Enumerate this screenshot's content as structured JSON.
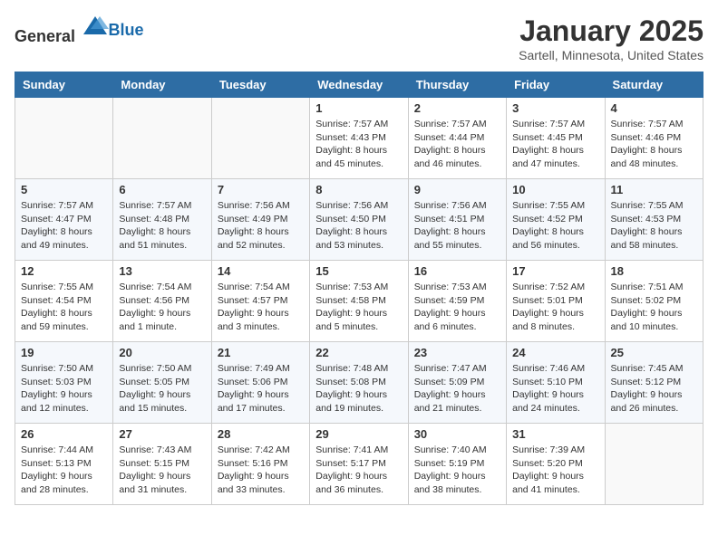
{
  "header": {
    "logo_general": "General",
    "logo_blue": "Blue",
    "month_title": "January 2025",
    "location": "Sartell, Minnesota, United States"
  },
  "weekdays": [
    "Sunday",
    "Monday",
    "Tuesday",
    "Wednesday",
    "Thursday",
    "Friday",
    "Saturday"
  ],
  "weeks": [
    [
      {
        "day": "",
        "info": ""
      },
      {
        "day": "",
        "info": ""
      },
      {
        "day": "",
        "info": ""
      },
      {
        "day": "1",
        "info": "Sunrise: 7:57 AM\nSunset: 4:43 PM\nDaylight: 8 hours\nand 45 minutes."
      },
      {
        "day": "2",
        "info": "Sunrise: 7:57 AM\nSunset: 4:44 PM\nDaylight: 8 hours\nand 46 minutes."
      },
      {
        "day": "3",
        "info": "Sunrise: 7:57 AM\nSunset: 4:45 PM\nDaylight: 8 hours\nand 47 minutes."
      },
      {
        "day": "4",
        "info": "Sunrise: 7:57 AM\nSunset: 4:46 PM\nDaylight: 8 hours\nand 48 minutes."
      }
    ],
    [
      {
        "day": "5",
        "info": "Sunrise: 7:57 AM\nSunset: 4:47 PM\nDaylight: 8 hours\nand 49 minutes."
      },
      {
        "day": "6",
        "info": "Sunrise: 7:57 AM\nSunset: 4:48 PM\nDaylight: 8 hours\nand 51 minutes."
      },
      {
        "day": "7",
        "info": "Sunrise: 7:56 AM\nSunset: 4:49 PM\nDaylight: 8 hours\nand 52 minutes."
      },
      {
        "day": "8",
        "info": "Sunrise: 7:56 AM\nSunset: 4:50 PM\nDaylight: 8 hours\nand 53 minutes."
      },
      {
        "day": "9",
        "info": "Sunrise: 7:56 AM\nSunset: 4:51 PM\nDaylight: 8 hours\nand 55 minutes."
      },
      {
        "day": "10",
        "info": "Sunrise: 7:55 AM\nSunset: 4:52 PM\nDaylight: 8 hours\nand 56 minutes."
      },
      {
        "day": "11",
        "info": "Sunrise: 7:55 AM\nSunset: 4:53 PM\nDaylight: 8 hours\nand 58 minutes."
      }
    ],
    [
      {
        "day": "12",
        "info": "Sunrise: 7:55 AM\nSunset: 4:54 PM\nDaylight: 8 hours\nand 59 minutes."
      },
      {
        "day": "13",
        "info": "Sunrise: 7:54 AM\nSunset: 4:56 PM\nDaylight: 9 hours\nand 1 minute."
      },
      {
        "day": "14",
        "info": "Sunrise: 7:54 AM\nSunset: 4:57 PM\nDaylight: 9 hours\nand 3 minutes."
      },
      {
        "day": "15",
        "info": "Sunrise: 7:53 AM\nSunset: 4:58 PM\nDaylight: 9 hours\nand 5 minutes."
      },
      {
        "day": "16",
        "info": "Sunrise: 7:53 AM\nSunset: 4:59 PM\nDaylight: 9 hours\nand 6 minutes."
      },
      {
        "day": "17",
        "info": "Sunrise: 7:52 AM\nSunset: 5:01 PM\nDaylight: 9 hours\nand 8 minutes."
      },
      {
        "day": "18",
        "info": "Sunrise: 7:51 AM\nSunset: 5:02 PM\nDaylight: 9 hours\nand 10 minutes."
      }
    ],
    [
      {
        "day": "19",
        "info": "Sunrise: 7:50 AM\nSunset: 5:03 PM\nDaylight: 9 hours\nand 12 minutes."
      },
      {
        "day": "20",
        "info": "Sunrise: 7:50 AM\nSunset: 5:05 PM\nDaylight: 9 hours\nand 15 minutes."
      },
      {
        "day": "21",
        "info": "Sunrise: 7:49 AM\nSunset: 5:06 PM\nDaylight: 9 hours\nand 17 minutes."
      },
      {
        "day": "22",
        "info": "Sunrise: 7:48 AM\nSunset: 5:08 PM\nDaylight: 9 hours\nand 19 minutes."
      },
      {
        "day": "23",
        "info": "Sunrise: 7:47 AM\nSunset: 5:09 PM\nDaylight: 9 hours\nand 21 minutes."
      },
      {
        "day": "24",
        "info": "Sunrise: 7:46 AM\nSunset: 5:10 PM\nDaylight: 9 hours\nand 24 minutes."
      },
      {
        "day": "25",
        "info": "Sunrise: 7:45 AM\nSunset: 5:12 PM\nDaylight: 9 hours\nand 26 minutes."
      }
    ],
    [
      {
        "day": "26",
        "info": "Sunrise: 7:44 AM\nSunset: 5:13 PM\nDaylight: 9 hours\nand 28 minutes."
      },
      {
        "day": "27",
        "info": "Sunrise: 7:43 AM\nSunset: 5:15 PM\nDaylight: 9 hours\nand 31 minutes."
      },
      {
        "day": "28",
        "info": "Sunrise: 7:42 AM\nSunset: 5:16 PM\nDaylight: 9 hours\nand 33 minutes."
      },
      {
        "day": "29",
        "info": "Sunrise: 7:41 AM\nSunset: 5:17 PM\nDaylight: 9 hours\nand 36 minutes."
      },
      {
        "day": "30",
        "info": "Sunrise: 7:40 AM\nSunset: 5:19 PM\nDaylight: 9 hours\nand 38 minutes."
      },
      {
        "day": "31",
        "info": "Sunrise: 7:39 AM\nSunset: 5:20 PM\nDaylight: 9 hours\nand 41 minutes."
      },
      {
        "day": "",
        "info": ""
      }
    ]
  ]
}
